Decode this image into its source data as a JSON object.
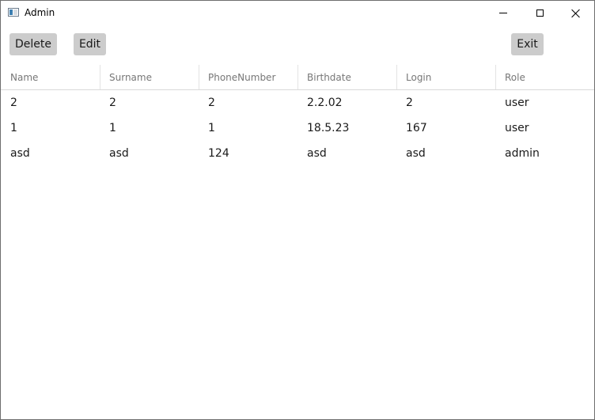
{
  "window": {
    "title": "Admin",
    "icon": "app-window-icon",
    "controls": [
      "minimize-icon",
      "maximize-icon",
      "close-icon"
    ]
  },
  "toolbar": {
    "delete_label": "Delete",
    "edit_label": "Edit",
    "exit_label": "Exit"
  },
  "grid": {
    "columns": [
      "Name",
      "Surname",
      "PhoneNumber",
      "Birthdate",
      "Login",
      "Role"
    ],
    "rows": [
      [
        "2",
        "2",
        "2",
        "2.2.02",
        "2",
        "user"
      ],
      [
        "1",
        "1",
        "1",
        "18.5.23",
        "167",
        "user"
      ],
      [
        "asd",
        "asd",
        "124",
        "asd",
        "asd",
        "admin"
      ]
    ]
  },
  "colors": {
    "button_bg": "#cccccc",
    "header_text": "#777777",
    "cell_text": "#1a1a1a"
  }
}
